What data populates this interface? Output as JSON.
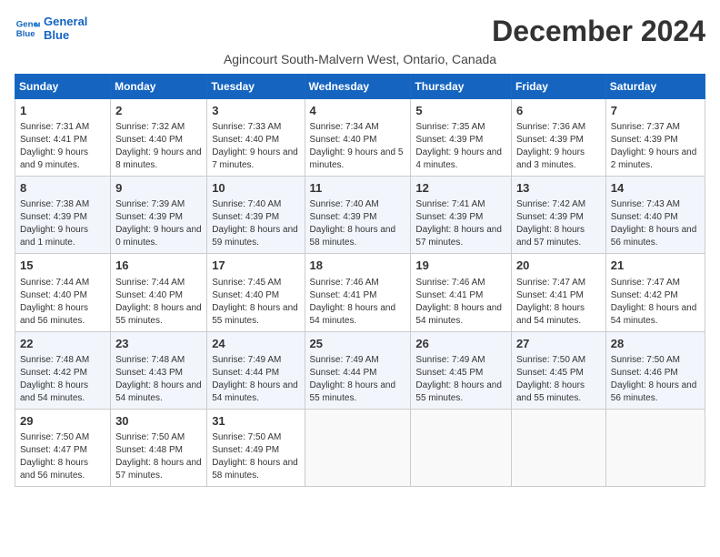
{
  "header": {
    "logo_line1": "General",
    "logo_line2": "Blue",
    "title": "December 2024",
    "subtitle": "Agincourt South-Malvern West, Ontario, Canada"
  },
  "days_of_week": [
    "Sunday",
    "Monday",
    "Tuesday",
    "Wednesday",
    "Thursday",
    "Friday",
    "Saturday"
  ],
  "weeks": [
    [
      {
        "day": 1,
        "sunrise": "7:31 AM",
        "sunset": "4:41 PM",
        "daylight": "9 hours and 9 minutes."
      },
      {
        "day": 2,
        "sunrise": "7:32 AM",
        "sunset": "4:40 PM",
        "daylight": "9 hours and 8 minutes."
      },
      {
        "day": 3,
        "sunrise": "7:33 AM",
        "sunset": "4:40 PM",
        "daylight": "9 hours and 7 minutes."
      },
      {
        "day": 4,
        "sunrise": "7:34 AM",
        "sunset": "4:40 PM",
        "daylight": "9 hours and 5 minutes."
      },
      {
        "day": 5,
        "sunrise": "7:35 AM",
        "sunset": "4:39 PM",
        "daylight": "9 hours and 4 minutes."
      },
      {
        "day": 6,
        "sunrise": "7:36 AM",
        "sunset": "4:39 PM",
        "daylight": "9 hours and 3 minutes."
      },
      {
        "day": 7,
        "sunrise": "7:37 AM",
        "sunset": "4:39 PM",
        "daylight": "9 hours and 2 minutes."
      }
    ],
    [
      {
        "day": 8,
        "sunrise": "7:38 AM",
        "sunset": "4:39 PM",
        "daylight": "9 hours and 1 minute."
      },
      {
        "day": 9,
        "sunrise": "7:39 AM",
        "sunset": "4:39 PM",
        "daylight": "9 hours and 0 minutes."
      },
      {
        "day": 10,
        "sunrise": "7:40 AM",
        "sunset": "4:39 PM",
        "daylight": "8 hours and 59 minutes."
      },
      {
        "day": 11,
        "sunrise": "7:40 AM",
        "sunset": "4:39 PM",
        "daylight": "8 hours and 58 minutes."
      },
      {
        "day": 12,
        "sunrise": "7:41 AM",
        "sunset": "4:39 PM",
        "daylight": "8 hours and 57 minutes."
      },
      {
        "day": 13,
        "sunrise": "7:42 AM",
        "sunset": "4:39 PM",
        "daylight": "8 hours and 57 minutes."
      },
      {
        "day": 14,
        "sunrise": "7:43 AM",
        "sunset": "4:40 PM",
        "daylight": "8 hours and 56 minutes."
      }
    ],
    [
      {
        "day": 15,
        "sunrise": "7:44 AM",
        "sunset": "4:40 PM",
        "daylight": "8 hours and 56 minutes."
      },
      {
        "day": 16,
        "sunrise": "7:44 AM",
        "sunset": "4:40 PM",
        "daylight": "8 hours and 55 minutes."
      },
      {
        "day": 17,
        "sunrise": "7:45 AM",
        "sunset": "4:40 PM",
        "daylight": "8 hours and 55 minutes."
      },
      {
        "day": 18,
        "sunrise": "7:46 AM",
        "sunset": "4:41 PM",
        "daylight": "8 hours and 54 minutes."
      },
      {
        "day": 19,
        "sunrise": "7:46 AM",
        "sunset": "4:41 PM",
        "daylight": "8 hours and 54 minutes."
      },
      {
        "day": 20,
        "sunrise": "7:47 AM",
        "sunset": "4:41 PM",
        "daylight": "8 hours and 54 minutes."
      },
      {
        "day": 21,
        "sunrise": "7:47 AM",
        "sunset": "4:42 PM",
        "daylight": "8 hours and 54 minutes."
      }
    ],
    [
      {
        "day": 22,
        "sunrise": "7:48 AM",
        "sunset": "4:42 PM",
        "daylight": "8 hours and 54 minutes."
      },
      {
        "day": 23,
        "sunrise": "7:48 AM",
        "sunset": "4:43 PM",
        "daylight": "8 hours and 54 minutes."
      },
      {
        "day": 24,
        "sunrise": "7:49 AM",
        "sunset": "4:44 PM",
        "daylight": "8 hours and 54 minutes."
      },
      {
        "day": 25,
        "sunrise": "7:49 AM",
        "sunset": "4:44 PM",
        "daylight": "8 hours and 55 minutes."
      },
      {
        "day": 26,
        "sunrise": "7:49 AM",
        "sunset": "4:45 PM",
        "daylight": "8 hours and 55 minutes."
      },
      {
        "day": 27,
        "sunrise": "7:50 AM",
        "sunset": "4:45 PM",
        "daylight": "8 hours and 55 minutes."
      },
      {
        "day": 28,
        "sunrise": "7:50 AM",
        "sunset": "4:46 PM",
        "daylight": "8 hours and 56 minutes."
      }
    ],
    [
      {
        "day": 29,
        "sunrise": "7:50 AM",
        "sunset": "4:47 PM",
        "daylight": "8 hours and 56 minutes."
      },
      {
        "day": 30,
        "sunrise": "7:50 AM",
        "sunset": "4:48 PM",
        "daylight": "8 hours and 57 minutes."
      },
      {
        "day": 31,
        "sunrise": "7:50 AM",
        "sunset": "4:49 PM",
        "daylight": "8 hours and 58 minutes."
      },
      null,
      null,
      null,
      null
    ]
  ]
}
